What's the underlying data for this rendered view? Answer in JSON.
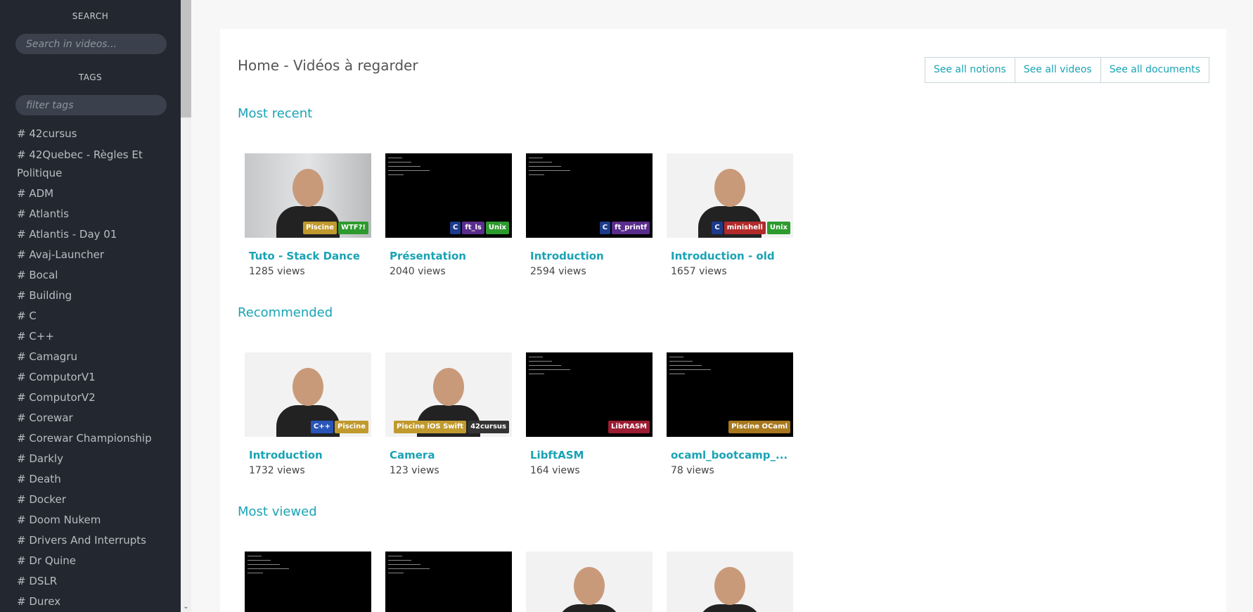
{
  "sidebar": {
    "search_heading": "SEARCH",
    "search_placeholder": "Search in videos...",
    "tags_heading": "TAGS",
    "filter_placeholder": "filter tags",
    "tags": [
      "# 42cursus",
      "# 42Quebec - Règles Et Politique",
      "# ADM",
      "# Atlantis",
      "# Atlantis - Day 01",
      "# Avaj-Launcher",
      "# Bocal",
      "# Building",
      "# C",
      "# C++",
      "# Camagru",
      "# ComputorV1",
      "# ComputorV2",
      "# Corewar",
      "# Corewar Championship",
      "# Darkly",
      "# Death",
      "# Docker",
      "# Doom Nukem",
      "# Drivers And Interrupts",
      "# Dr Quine",
      "# DSLR",
      "# Durex"
    ]
  },
  "header": {
    "title": "Home - Vidéos à regarder",
    "buttons": [
      "See all notions",
      "See all videos",
      "See all documents"
    ]
  },
  "sections": [
    {
      "title": "Most recent",
      "videos": [
        {
          "title": "Tuto - Stack Dance",
          "views": "1285 views",
          "badges": [
            {
              "label": "Piscine",
              "color": "#c19a2e"
            },
            {
              "label": "WTF?!",
              "color": "#2d9a2d"
            }
          ]
        },
        {
          "title": "Présentation",
          "views": "2040 views",
          "badges": [
            {
              "label": "C",
              "color": "#1d3b8c"
            },
            {
              "label": "ft_ls",
              "color": "#5a2d8c"
            },
            {
              "label": "Unix",
              "color": "#2d9a2d"
            }
          ]
        },
        {
          "title": "Introduction",
          "views": "2594 views",
          "badges": [
            {
              "label": "C",
              "color": "#1d3b8c"
            },
            {
              "label": "ft_printf",
              "color": "#5a2d8c"
            }
          ]
        },
        {
          "title": "Introduction - old",
          "views": "1657 views",
          "badges": [
            {
              "label": "C",
              "color": "#1d3b8c"
            },
            {
              "label": "minishell",
              "color": "#b22a2a"
            },
            {
              "label": "Unix",
              "color": "#2d9a2d"
            }
          ]
        }
      ]
    },
    {
      "title": "Recommended",
      "videos": [
        {
          "title": "Introduction",
          "views": "1732 views",
          "badges": [
            {
              "label": "C++",
              "color": "#2a55b8"
            },
            {
              "label": "Piscine",
              "color": "#c19a2e"
            }
          ]
        },
        {
          "title": "Camera",
          "views": "123 views",
          "badges": [
            {
              "label": "Piscine iOS Swift",
              "color": "#c19a2e"
            },
            {
              "label": "42cursus",
              "color": "#333333"
            }
          ]
        },
        {
          "title": "LibftASM",
          "views": "164 views",
          "badges": [
            {
              "label": "LibftASM",
              "color": "#9c1d33"
            }
          ]
        },
        {
          "title": "ocaml_bootcamp_...",
          "views": "78 views",
          "badges": [
            {
              "label": "Piscine OCaml",
              "color": "#a8781e"
            }
          ]
        }
      ]
    },
    {
      "title": "Most viewed",
      "videos": [
        {
          "title": "",
          "views": "",
          "badges": []
        },
        {
          "title": "",
          "views": "",
          "badges": []
        },
        {
          "title": "",
          "views": "",
          "badges": []
        },
        {
          "title": "",
          "views": "",
          "badges": []
        }
      ]
    }
  ]
}
